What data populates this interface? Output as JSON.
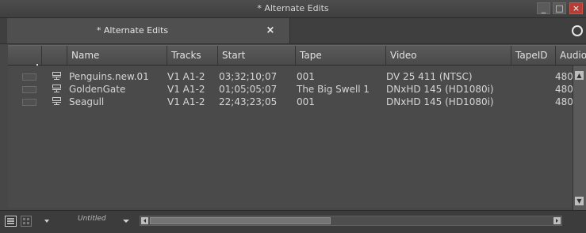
{
  "window": {
    "title": "* Alternate Edits",
    "minimize_glyph": "_",
    "maximize_glyph": "□",
    "close_glyph": "×"
  },
  "tab": {
    "label": "* Alternate Edits",
    "close_glyph": "×"
  },
  "table": {
    "headers": [
      "Name",
      "Tracks",
      "Start",
      "Tape",
      "Video",
      "TapeID",
      "Audio"
    ],
    "rows": [
      {
        "name": "Penguins.new.01",
        "tracks": "V1 A1-2",
        "start": "03;32;10;07",
        "tape": "001",
        "video": "DV 25 411 (NTSC)",
        "audio": "480"
      },
      {
        "name": "GoldenGate",
        "tracks": "V1 A1-2",
        "start": "01;05;05;07",
        "tape": "The Big Swell 1",
        "video": "DNxHD 145 (HD1080i)",
        "audio": "480"
      },
      {
        "name": "Seagull",
        "tracks": "V1 A1-2",
        "start": "22;43;23;05",
        "tape": "001",
        "video": "DNxHD 145 (HD1080i)",
        "audio": "480"
      }
    ]
  },
  "bottombar": {
    "view_label": "Untitled"
  },
  "icons": {
    "clip": "sequence-clip-icon",
    "menu": "hamburger-icon"
  },
  "colors": {
    "close_button": "#b83c33",
    "background": "#474747"
  }
}
